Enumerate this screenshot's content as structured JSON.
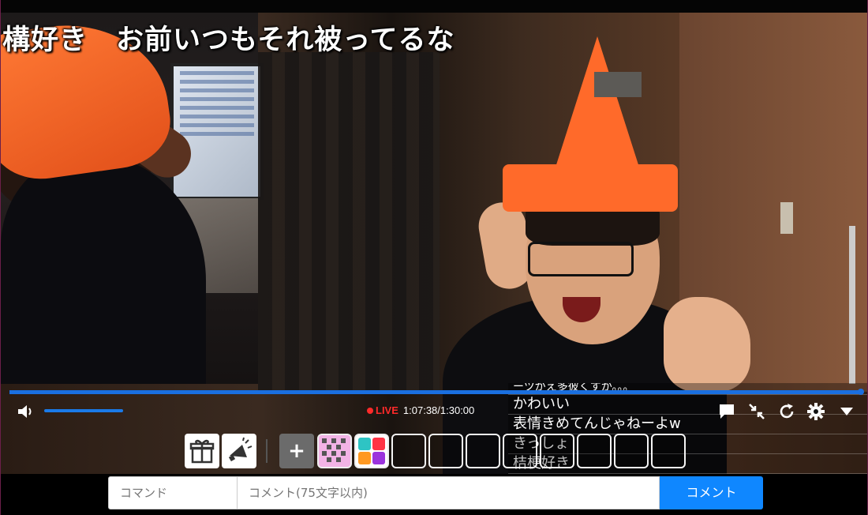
{
  "overlay": {
    "scrolling_comment": "構好き　お前いつもそれ被ってるな"
  },
  "comments": [
    "ーツがえ多彼くすか。。。",
    "かわいい",
    "表情きめてんじゃねーよw",
    "きっしょ",
    "桔梗好き"
  ],
  "player": {
    "live_label": "LIVE",
    "time_display": "1:07:38/1:30:00",
    "seek_progress": 0.995,
    "volume_level": 0.9,
    "accent_color": "#1a7ae8",
    "live_color": "#ff2a2a"
  },
  "controls": {
    "icons": [
      "volume-icon",
      "comment-toggle-icon",
      "exit-fullscreen-icon",
      "reload-icon",
      "settings-icon",
      "dropdown-arrow-icon"
    ]
  },
  "items": {
    "gift_icon": "gift-icon",
    "nicoad_icon": "megaphone-icon",
    "add_label": "+",
    "slots_empty": 8
  },
  "form": {
    "command_placeholder": "コマンド",
    "comment_placeholder": "コメント(75文字以内)",
    "submit_label": "コメント",
    "submit_color": "#0f87ff"
  }
}
